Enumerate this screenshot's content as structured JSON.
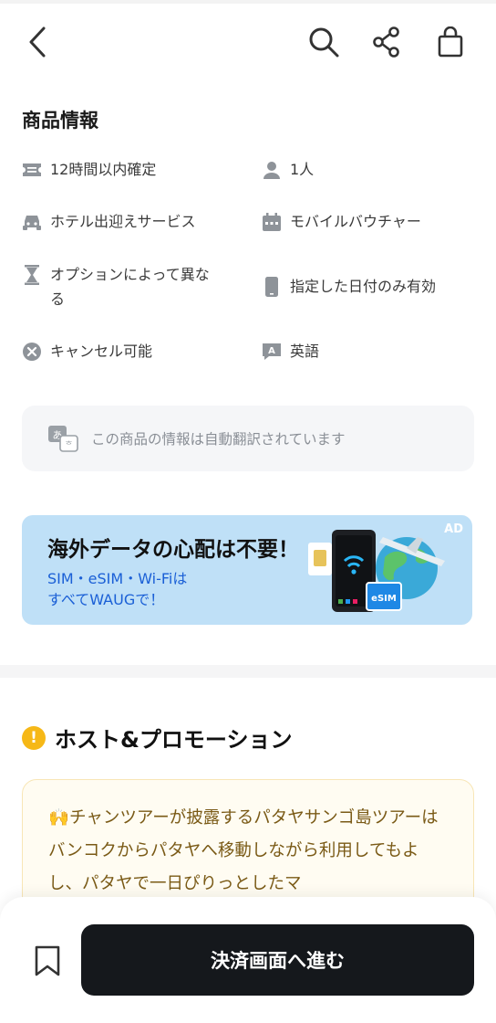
{
  "header": {
    "back_icon": "chevron-left-icon",
    "search_icon": "search-icon",
    "share_icon": "share-icon",
    "cart_icon": "shopping-bag-icon"
  },
  "product_info": {
    "title": "商品情報",
    "items": [
      {
        "icon": "ticket-icon",
        "label": "12時間以内確定"
      },
      {
        "icon": "person-icon",
        "label": "1人"
      },
      {
        "icon": "car-icon",
        "label": "ホテル出迎えサービス"
      },
      {
        "icon": "calendar-icon",
        "label": "モバイルバウチャー"
      },
      {
        "icon": "hourglass-icon",
        "label": "オプションによって異な\nる"
      },
      {
        "icon": "phone-icon",
        "label": "指定した日付のみ有効"
      },
      {
        "icon": "cancel-circle-icon",
        "label": "キャンセル可能"
      },
      {
        "icon": "language-icon",
        "label": "英語"
      }
    ]
  },
  "translation_notice": {
    "icon": "translate-icon",
    "text": "この商品の情報は自動翻訳されています"
  },
  "ad_banner": {
    "title": "海外データの心配は不要！",
    "subtitle_line1": "SIM・eSIM・Wi-Fiは",
    "subtitle_line2": "すべてWAUGで！",
    "tag": "AD",
    "esim_label": "eSIM",
    "colors": {
      "background": "#bfe0f7",
      "subtitle": "#1a5fd6"
    }
  },
  "host_section": {
    "title": "ホスト&プロモーション",
    "text": "🙌チャンツアーが披露するパタヤサンゴ島ツアーはバンコクからパタヤへ移動しながら利用してもよし、パタヤで一日ぴりっとしたマ"
  },
  "bottom_bar": {
    "bookmark_icon": "bookmark-icon",
    "pay_label": "決済画面へ進む"
  }
}
